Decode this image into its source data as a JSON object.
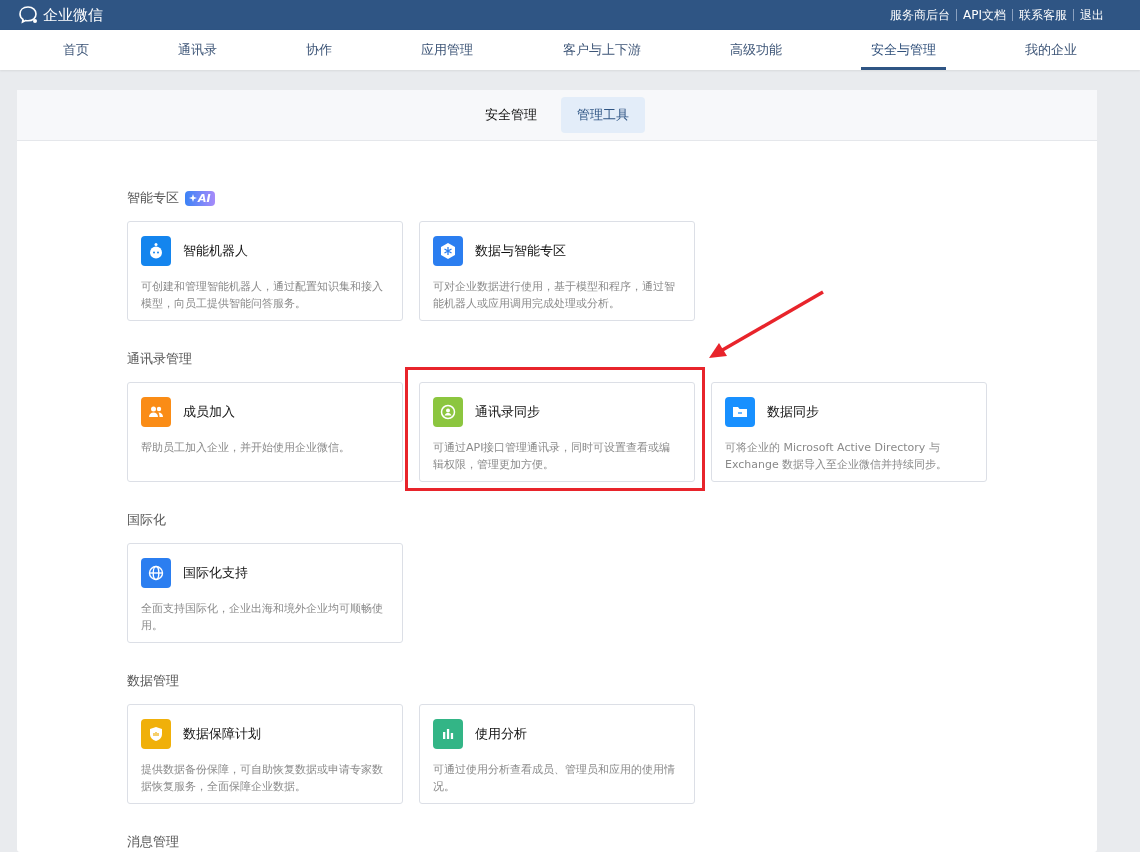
{
  "topbar": {
    "logo": "企业微信",
    "links": [
      "服务商后台",
      "API文档",
      "联系客服",
      "退出"
    ]
  },
  "nav": [
    {
      "label": "首页",
      "selected": false
    },
    {
      "label": "通讯录",
      "selected": false
    },
    {
      "label": "协作",
      "selected": false
    },
    {
      "label": "应用管理",
      "selected": false
    },
    {
      "label": "客户与上下游",
      "selected": false
    },
    {
      "label": "高级功能",
      "selected": false
    },
    {
      "label": "安全与管理",
      "selected": true
    },
    {
      "label": "我的企业",
      "selected": false
    }
  ],
  "tabs": [
    {
      "label": "安全管理",
      "selected": false
    },
    {
      "label": "管理工具",
      "selected": true
    }
  ],
  "sections": [
    {
      "title": "智能专区",
      "badge": "AI",
      "cards": [
        {
          "kind": "robot",
          "color": "#1485ee",
          "title": "智能机器人",
          "desc": "可创建和管理智能机器人，通过配置知识集和接入模型，向员工提供智能问答服务。",
          "highlighted": false
        },
        {
          "kind": "hexagon",
          "color": "#2b7ef0",
          "title": "数据与智能专区",
          "desc": "可对企业数据进行使用，基于模型和程序，通过智能机器人或应用调用完成处理或分析。",
          "highlighted": false
        }
      ]
    },
    {
      "title": "通讯录管理",
      "cards": [
        {
          "kind": "people",
          "color": "#fa8c16",
          "title": "成员加入",
          "desc": "帮助员工加入企业，并开始使用企业微信。",
          "highlighted": false
        },
        {
          "kind": "sync",
          "color": "#8cc63f",
          "title": "通讯录同步",
          "desc": "可通过API接口管理通讯录，同时可设置查看或编辑权限，管理更加方便。",
          "highlighted": true
        },
        {
          "kind": "folder",
          "color": "#1890ff",
          "title": "数据同步",
          "desc": "可将企业的 Microsoft Active Directory 与 Exchange 数据导入至企业微信并持续同步。",
          "highlighted": false
        }
      ]
    },
    {
      "title": "国际化",
      "cards": [
        {
          "kind": "globe",
          "color": "#2b7ef0",
          "title": "国际化支持",
          "desc": "全面支持国际化，企业出海和境外企业均可顺畅使用。",
          "highlighted": false
        }
      ]
    },
    {
      "title": "数据管理",
      "cards": [
        {
          "kind": "shield",
          "color": "#f0b00a",
          "title": "数据保障计划",
          "desc": "提供数据备份保障，可自助恢复数据或申请专家数据恢复服务，全面保障企业数据。",
          "highlighted": false
        },
        {
          "kind": "chart",
          "color": "#33b586",
          "title": "使用分析",
          "desc": "可通过使用分析查看成员、管理员和应用的使用情况。",
          "highlighted": false
        }
      ]
    },
    {
      "title": "消息管理"
    }
  ]
}
